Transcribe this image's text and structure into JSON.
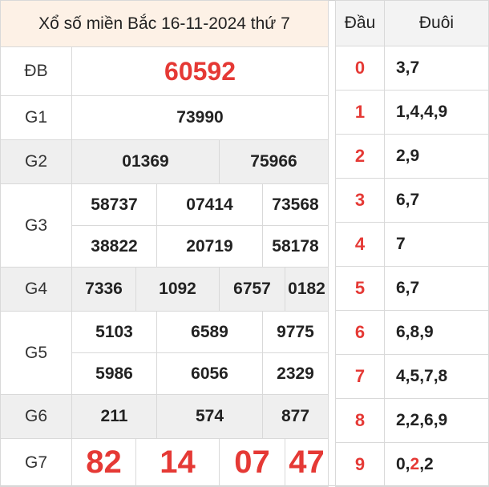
{
  "title": "Xổ số miền Bắc 16-11-2024 thứ 7",
  "prizes": {
    "db": {
      "label": "ĐB",
      "values": [
        "60592"
      ]
    },
    "g1": {
      "label": "G1",
      "values": [
        "73990"
      ]
    },
    "g2": {
      "label": "G2",
      "values": [
        "01369",
        "75966"
      ]
    },
    "g3": {
      "label": "G3",
      "values": [
        "58737",
        "07414",
        "73568",
        "38822",
        "20719",
        "58178"
      ]
    },
    "g4": {
      "label": "G4",
      "values": [
        "7336",
        "1092",
        "6757",
        "0182"
      ]
    },
    "g5": {
      "label": "G5",
      "values": [
        "5103",
        "6589",
        "9775",
        "5986",
        "6056",
        "2329"
      ]
    },
    "g6": {
      "label": "G6",
      "values": [
        "211",
        "574",
        "877"
      ]
    },
    "g7": {
      "label": "G7",
      "values": [
        "82",
        "14",
        "07",
        "47"
      ]
    }
  },
  "loto": {
    "head_label": "Đầu",
    "tail_label": "Đuôi",
    "rows": [
      {
        "head": "0",
        "tail": "3,7"
      },
      {
        "head": "1",
        "tail": "1,4,4,9"
      },
      {
        "head": "2",
        "tail": "2,9"
      },
      {
        "head": "3",
        "tail": "6,7"
      },
      {
        "head": "4",
        "tail": "7"
      },
      {
        "head": "5",
        "tail": "6,7"
      },
      {
        "head": "6",
        "tail": "6,8,9"
      },
      {
        "head": "7",
        "tail": "4,5,7,8"
      },
      {
        "head": "8",
        "tail": "2,2,6,9"
      },
      {
        "head": "9",
        "tail_parts": [
          "0,",
          "2",
          ",2"
        ]
      }
    ]
  },
  "colors": {
    "accent": "#e53935",
    "header_bg": "#fdf1e6",
    "alt_row": "#efefef"
  }
}
